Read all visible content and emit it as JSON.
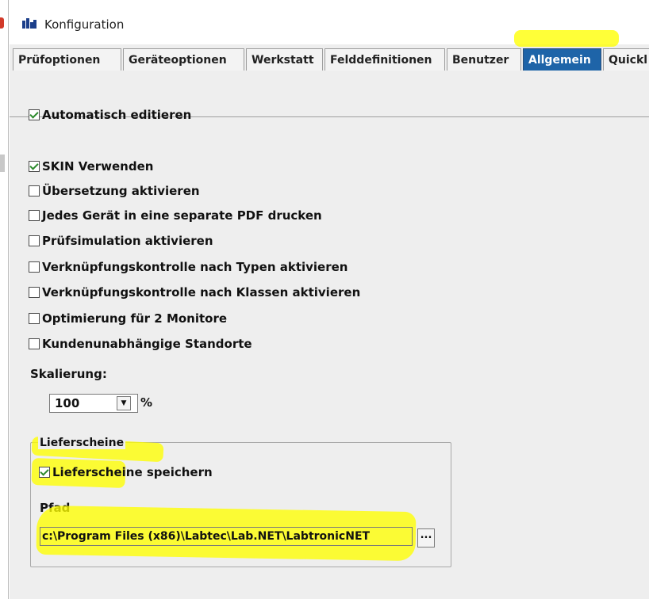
{
  "window": {
    "title": "Konfiguration"
  },
  "tabs": [
    {
      "label": "Prüfoptionen"
    },
    {
      "label": "Geräteoptionen"
    },
    {
      "label": "Werkstatt"
    },
    {
      "label": "Felddefinitionen"
    },
    {
      "label": "Benutzer"
    },
    {
      "label": "Allgemein",
      "active": true
    },
    {
      "label": "Quickl"
    }
  ],
  "options": {
    "auto_edit": {
      "label": "Automatisch editieren",
      "checked": true
    },
    "skin": {
      "label": "SKIN Verwenden",
      "checked": true
    },
    "translation": {
      "label": "Übersetzung aktivieren",
      "checked": false
    },
    "separate_pdf": {
      "label": "Jedes Gerät in eine separate PDF drucken",
      "checked": false
    },
    "test_simulation": {
      "label": "Prüfsimulation aktivieren",
      "checked": false
    },
    "link_types": {
      "label": "Verknüpfungskontrolle nach Typen aktivieren",
      "checked": false
    },
    "link_classes": {
      "label": "Verknüpfungskontrolle nach Klassen aktivieren",
      "checked": false
    },
    "dual_monitor": {
      "label": "Optimierung für 2 Monitore",
      "checked": false
    },
    "locations": {
      "label": "Kundenunabhängige Standorte",
      "checked": false
    }
  },
  "scaling": {
    "label": "Skalierung:",
    "value": "100",
    "unit": "%"
  },
  "delivery_notes": {
    "group_title": "Lieferscheine",
    "save": {
      "label": "Lieferscheine speichern",
      "checked": true
    },
    "path_label": "Pfad",
    "path_value": "c:\\Program Files (x86)\\Labtec\\Lab.NET\\LabtronicNET",
    "browse_label": "..."
  },
  "colors": {
    "active_tab": "#1e64a8",
    "highlight": "#ffff00",
    "check": "#2c8a2c"
  }
}
